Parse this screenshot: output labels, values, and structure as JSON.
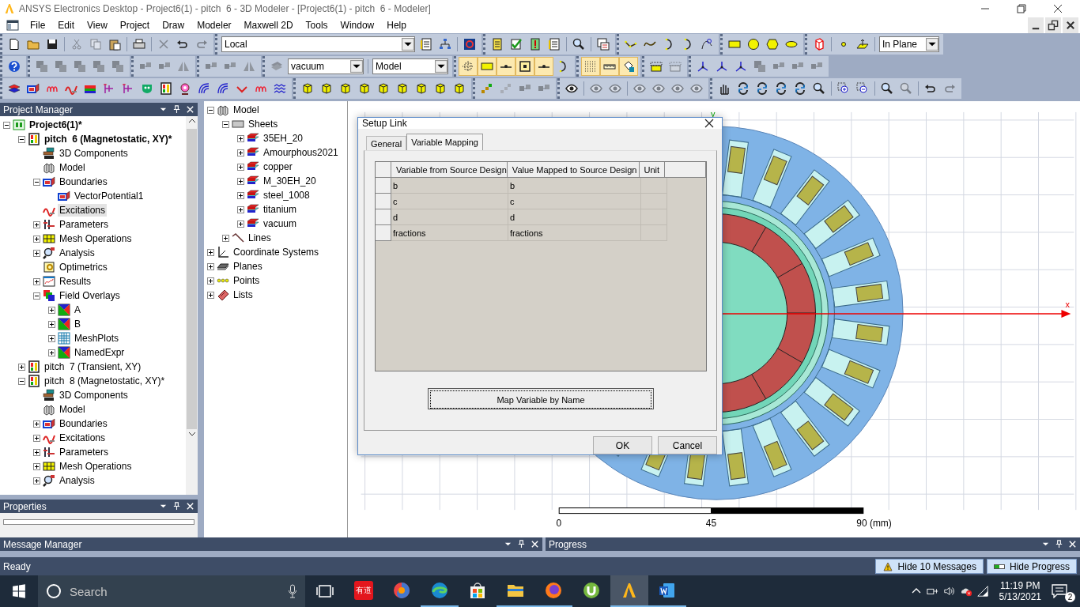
{
  "window": {
    "title": "ANSYS Electronics Desktop - Project6(1) - pitch  6 - 3D Modeler - [Project6(1) - pitch  6 - Modeler]"
  },
  "menu": [
    "File",
    "Edit",
    "View",
    "Project",
    "Draw",
    "Modeler",
    "Maxwell 2D",
    "Tools",
    "Window",
    "Help"
  ],
  "toolbars": [
    [
      [
        {
          "kind": "new",
          "disabled": false
        },
        {
          "kind": "open",
          "disabled": false
        },
        {
          "kind": "save",
          "disabled": false
        },
        {
          "kind": "separator"
        },
        {
          "kind": "cut",
          "disabled": true
        },
        {
          "kind": "copy",
          "disabled": true
        },
        {
          "kind": "paste",
          "disabled": false
        },
        {
          "kind": "separator"
        },
        {
          "kind": "print",
          "disabled": false
        },
        {
          "kind": "separator"
        },
        {
          "kind": "delete",
          "disabled": true
        },
        {
          "kind": "undo",
          "disabled": false
        },
        {
          "kind": "redo",
          "disabled": true
        }
      ],
      [
        {
          "kind": "dropdown",
          "value": "Local"
        },
        {
          "kind": "doclist",
          "disabled": false
        },
        {
          "kind": "tree",
          "disabled": false
        },
        {
          "kind": "separator"
        },
        {
          "kind": "ringbox",
          "disabled": false
        }
      ],
      [
        {
          "kind": "notes",
          "disabled": false
        },
        {
          "kind": "check",
          "disabled": false
        },
        {
          "kind": "validate",
          "disabled": false
        },
        {
          "kind": "doclist",
          "disabled": false
        },
        {
          "kind": "separator"
        },
        {
          "kind": "zoom",
          "disabled": false
        },
        {
          "kind": "separator"
        },
        {
          "kind": "windowgrid",
          "disabled": false
        }
      ],
      [
        {
          "kind": "polyline",
          "disabled": false
        },
        {
          "kind": "spline",
          "disabled": false
        },
        {
          "kind": "arc",
          "disabled": false
        },
        {
          "kind": "arc",
          "disabled": false
        },
        {
          "kind": "curve",
          "disabled": false
        }
      ],
      [
        {
          "kind": "rect",
          "disabled": false
        },
        {
          "kind": "circle",
          "disabled": false
        },
        {
          "kind": "hexagon",
          "disabled": false
        },
        {
          "kind": "ellipse",
          "disabled": false
        }
      ],
      [
        {
          "kind": "redcube",
          "disabled": false
        },
        {
          "kind": "separator"
        },
        {
          "kind": "point",
          "disabled": false
        },
        {
          "kind": "plane",
          "disabled": false
        },
        {
          "kind": "separator"
        },
        {
          "kind": "dropdown",
          "value": "In Plane"
        }
      ]
    ],
    [
      [
        {
          "kind": "help",
          "disabled": false
        }
      ],
      [
        {
          "kind": "boolean",
          "disabled": true
        },
        {
          "kind": "boolean",
          "disabled": true
        },
        {
          "kind": "boolean",
          "disabled": true
        },
        {
          "kind": "boolean",
          "disabled": true
        },
        {
          "kind": "boolean",
          "disabled": true
        }
      ],
      [
        {
          "kind": "move",
          "disabled": true
        },
        {
          "kind": "move",
          "disabled": true
        },
        {
          "kind": "mirror",
          "disabled": true
        }
      ],
      [
        {
          "kind": "move",
          "disabled": true
        },
        {
          "kind": "move",
          "disabled": true
        },
        {
          "kind": "mirror",
          "disabled": true
        }
      ],
      [
        {
          "kind": "sweep",
          "disabled": true
        },
        {
          "kind": "dropdown",
          "value": "vacuum"
        },
        {
          "kind": "separator"
        },
        {
          "kind": "dropdown",
          "value": "Model"
        }
      ],
      [
        {
          "kind": "crosshair",
          "disabled": false,
          "on": true
        },
        {
          "kind": "rect",
          "disabled": false,
          "on": true
        },
        {
          "kind": "linepoint",
          "disabled": false,
          "on": true
        },
        {
          "kind": "centerpoint",
          "disabled": false,
          "on": true
        },
        {
          "kind": "linepoint",
          "disabled": false,
          "on": true
        },
        {
          "kind": "arc",
          "disabled": false,
          "on": false
        }
      ],
      [
        {
          "kind": "grid",
          "disabled": false,
          "on": true
        },
        {
          "kind": "ruler",
          "disabled": false,
          "on": true
        },
        {
          "kind": "paint",
          "disabled": false,
          "on": true
        }
      ],
      [
        {
          "kind": "region",
          "disabled": false
        },
        {
          "kind": "region",
          "disabled": true
        }
      ],
      [
        {
          "kind": "axes3",
          "disabled": false
        },
        {
          "kind": "axes3",
          "disabled": false
        },
        {
          "kind": "axes3",
          "disabled": false
        },
        {
          "kind": "boolean",
          "disabled": true
        },
        {
          "kind": "move",
          "disabled": true
        },
        {
          "kind": "move",
          "disabled": true
        },
        {
          "kind": "move",
          "disabled": true
        }
      ]
    ],
    [
      [
        {
          "kind": "layers",
          "disabled": false
        },
        {
          "kind": "boundaries",
          "disabled": false
        },
        {
          "kind": "coil",
          "disabled": false
        },
        {
          "kind": "excitations",
          "disabled": false
        },
        {
          "kind": "colorbars",
          "disabled": false
        },
        {
          "kind": "branch",
          "disabled": false
        },
        {
          "kind": "branch",
          "disabled": false
        },
        {
          "kind": "mask",
          "disabled": false
        },
        {
          "kind": "design",
          "disabled": false
        },
        {
          "kind": "target",
          "disabled": false
        },
        {
          "kind": "field",
          "disabled": false
        },
        {
          "kind": "field",
          "disabled": false
        },
        {
          "kind": "arrowdown",
          "disabled": false
        },
        {
          "kind": "coil",
          "disabled": false
        },
        {
          "kind": "waves",
          "disabled": false
        }
      ],
      [
        {
          "kind": "yellowcube",
          "disabled": false
        },
        {
          "kind": "yellowcube",
          "disabled": false
        },
        {
          "kind": "yellowcube",
          "disabled": false
        },
        {
          "kind": "yellowcube",
          "disabled": false
        },
        {
          "kind": "yellowcube",
          "disabled": false
        },
        {
          "kind": "yellowcube",
          "disabled": false
        },
        {
          "kind": "yellowcube",
          "disabled": false
        },
        {
          "kind": "yellowcube",
          "disabled": false
        },
        {
          "kind": "yellowcube",
          "disabled": false
        }
      ],
      [
        {
          "kind": "nodes",
          "disabled": false
        },
        {
          "kind": "nodes",
          "disabled": true
        },
        {
          "kind": "move",
          "disabled": true
        },
        {
          "kind": "move",
          "disabled": true
        }
      ],
      [
        {
          "kind": "eye",
          "disabled": false
        },
        {
          "kind": "separator"
        },
        {
          "kind": "eye",
          "disabled": true
        },
        {
          "kind": "eye",
          "disabled": true
        },
        {
          "kind": "separator"
        },
        {
          "kind": "eye",
          "disabled": true
        },
        {
          "kind": "eye",
          "disabled": true
        },
        {
          "kind": "eye",
          "disabled": true
        },
        {
          "kind": "eye",
          "disabled": true
        }
      ],
      [
        {
          "kind": "hand",
          "disabled": false
        },
        {
          "kind": "rotate",
          "disabled": false
        },
        {
          "kind": "rotate",
          "disabled": false
        },
        {
          "kind": "rotate",
          "disabled": false
        },
        {
          "kind": "rotate",
          "disabled": false
        },
        {
          "kind": "zoom",
          "disabled": false
        },
        {
          "kind": "separator"
        },
        {
          "kind": "zoomin",
          "disabled": false
        },
        {
          "kind": "zoomout",
          "disabled": false
        },
        {
          "kind": "separator"
        },
        {
          "kind": "zoom",
          "disabled": false
        },
        {
          "kind": "zoom",
          "disabled": true
        },
        {
          "kind": "separator"
        },
        {
          "kind": "undo",
          "disabled": false
        },
        {
          "kind": "redo",
          "disabled": true
        }
      ]
    ]
  ],
  "project_manager": {
    "title": "Project Manager",
    "tree": [
      {
        "kind": "project",
        "label": "Project6(1)*",
        "expandable": true,
        "expanded": true,
        "selected": false,
        "children": [
          {
            "kind": "design",
            "label": "pitch  6 (Magnetostatic, XY)*",
            "active": true,
            "expandable": true,
            "expanded": true,
            "selected": false,
            "children": [
              {
                "kind": "components",
                "label": "3D Components",
                "expandable": false,
                "selected": false
              },
              {
                "kind": "model",
                "label": "Model",
                "expandable": false,
                "selected": false
              },
              {
                "kind": "boundaries",
                "label": "Boundaries",
                "expandable": true,
                "expanded": true,
                "selected": false,
                "children": [
                  {
                    "kind": "boundaries",
                    "label": "VectorPotential1",
                    "expandable": false,
                    "selected": false
                  }
                ]
              },
              {
                "kind": "excitations",
                "label": "Excitations",
                "expandable": false,
                "selected": true
              },
              {
                "kind": "parameters",
                "label": "Parameters",
                "expandable": true,
                "expanded": false,
                "selected": false
              },
              {
                "kind": "mesh",
                "label": "Mesh Operations",
                "expandable": true,
                "expanded": false,
                "selected": false
              },
              {
                "kind": "analysis",
                "label": "Analysis",
                "expandable": true,
                "expanded": false,
                "selected": false
              },
              {
                "kind": "optimetrics",
                "label": "Optimetrics",
                "expandable": false,
                "selected": false
              },
              {
                "kind": "results",
                "label": "Results",
                "expandable": true,
                "expanded": false,
                "selected": false
              },
              {
                "kind": "overlays",
                "label": "Field Overlays",
                "expandable": true,
                "expanded": true,
                "selected": false,
                "children": [
                  {
                    "kind": "plot",
                    "label": "A",
                    "expandable": true,
                    "expanded": false,
                    "selected": false
                  },
                  {
                    "kind": "plot",
                    "label": "B",
                    "expandable": true,
                    "expanded": false,
                    "selected": false
                  },
                  {
                    "kind": "meshplot",
                    "label": "MeshPlots",
                    "expandable": true,
                    "expanded": false,
                    "selected": false
                  },
                  {
                    "kind": "plot",
                    "label": "NamedExpr",
                    "expandable": true,
                    "expanded": false,
                    "selected": false
                  }
                ]
              }
            ]
          },
          {
            "kind": "design",
            "label": "pitch  7 (Transient, XY)",
            "active": false,
            "expandable": true,
            "expanded": false,
            "selected": false
          },
          {
            "kind": "design",
            "label": "pitch  8 (Magnetostatic, XY)*",
            "active": false,
            "expandable": true,
            "expanded": true,
            "selected": false,
            "children": [
              {
                "kind": "components",
                "label": "3D Components",
                "expandable": false,
                "selected": false
              },
              {
                "kind": "model",
                "label": "Model",
                "expandable": false,
                "selected": false
              },
              {
                "kind": "boundaries",
                "label": "Boundaries",
                "expandable": true,
                "expanded": false,
                "selected": false
              },
              {
                "kind": "excitations",
                "label": "Excitations",
                "expandable": true,
                "expanded": false,
                "selected": false
              },
              {
                "kind": "parameters",
                "label": "Parameters",
                "expandable": true,
                "expanded": false,
                "selected": false
              },
              {
                "kind": "mesh",
                "label": "Mesh Operations",
                "expandable": true,
                "expanded": false,
                "selected": false
              },
              {
                "kind": "analysis",
                "label": "Analysis",
                "expandable": true,
                "expanded": false,
                "selected": false
              }
            ]
          }
        ]
      }
    ]
  },
  "properties": {
    "title": "Properties"
  },
  "model_tree": [
    {
      "kind": "model",
      "label": "Model",
      "expandable": true,
      "expanded": true,
      "children": [
        {
          "kind": "sheets",
          "label": "Sheets",
          "expandable": true,
          "expanded": true,
          "children": [
            {
              "kind": "material",
              "label": "35EH_20",
              "expandable": true,
              "expanded": false
            },
            {
              "kind": "material",
              "label": "Amourphous2021",
              "expandable": true,
              "expanded": false
            },
            {
              "kind": "material",
              "label": "copper",
              "expandable": true,
              "expanded": false
            },
            {
              "kind": "material",
              "label": "M_30EH_20",
              "expandable": true,
              "expanded": false
            },
            {
              "kind": "material",
              "label": "steel_1008",
              "expandable": true,
              "expanded": false
            },
            {
              "kind": "material",
              "label": "titanium",
              "expandable": true,
              "expanded": false
            },
            {
              "kind": "material",
              "label": "vacuum",
              "expandable": true,
              "expanded": false
            }
          ]
        },
        {
          "kind": "lines",
          "label": "Lines",
          "expandable": true,
          "expanded": false
        }
      ]
    },
    {
      "kind": "coords",
      "label": "Coordinate Systems",
      "expandable": true,
      "expanded": false
    },
    {
      "kind": "planes",
      "label": "Planes",
      "expandable": true,
      "expanded": false
    },
    {
      "kind": "points",
      "label": "Points",
      "expandable": true,
      "expanded": false
    },
    {
      "kind": "lists",
      "label": "Lists",
      "expandable": true,
      "expanded": false
    }
  ],
  "viewport": {
    "axis_x": "x",
    "axis_y": "y",
    "scale_labels": [
      "0",
      "45",
      "90 (mm)"
    ]
  },
  "dialog": {
    "title": "Setup Link",
    "tabs": [
      {
        "label": "General",
        "selected": false
      },
      {
        "label": "Variable Mapping",
        "selected": true
      }
    ],
    "table": {
      "columns": [
        "Variable from Source Design",
        "Value Mapped to Source Design",
        "Unit"
      ],
      "rows": [
        {
          "variable": "b",
          "value": "b"
        },
        {
          "variable": "c",
          "value": "c"
        },
        {
          "variable": "d",
          "value": "d"
        },
        {
          "variable": "fractions",
          "value": "fractions"
        }
      ]
    },
    "map_button": "Map Variable by Name",
    "buttons": [
      "OK",
      "Cancel"
    ]
  },
  "message_manager": {
    "title": "Message Manager"
  },
  "progress": {
    "title": "Progress"
  },
  "status_bar": {
    "text": "Ready",
    "buttons": [
      {
        "kind": "warning",
        "label": "Hide 10 Messages"
      },
      {
        "kind": "progress",
        "label": "Hide Progress"
      }
    ]
  },
  "taskbar": {
    "search": {
      "placeholder": "Search"
    },
    "apps": [
      {
        "kind": "dictionary",
        "label": "有道",
        "active": false,
        "running": false
      },
      {
        "kind": "swirl",
        "active": false,
        "running": false
      },
      {
        "kind": "browser",
        "active": false,
        "running": true
      },
      {
        "kind": "store",
        "active": false,
        "running": false
      },
      {
        "kind": "folder",
        "active": false,
        "running": true
      },
      {
        "kind": "fox",
        "active": false,
        "running": true
      },
      {
        "kind": "torrent",
        "active": false,
        "running": false
      },
      {
        "kind": "ansys",
        "active": true,
        "running": true
      },
      {
        "kind": "word",
        "active": false,
        "running": true
      }
    ],
    "time": "11:19 PM",
    "date": "5/13/2021",
    "notifications": "2"
  }
}
